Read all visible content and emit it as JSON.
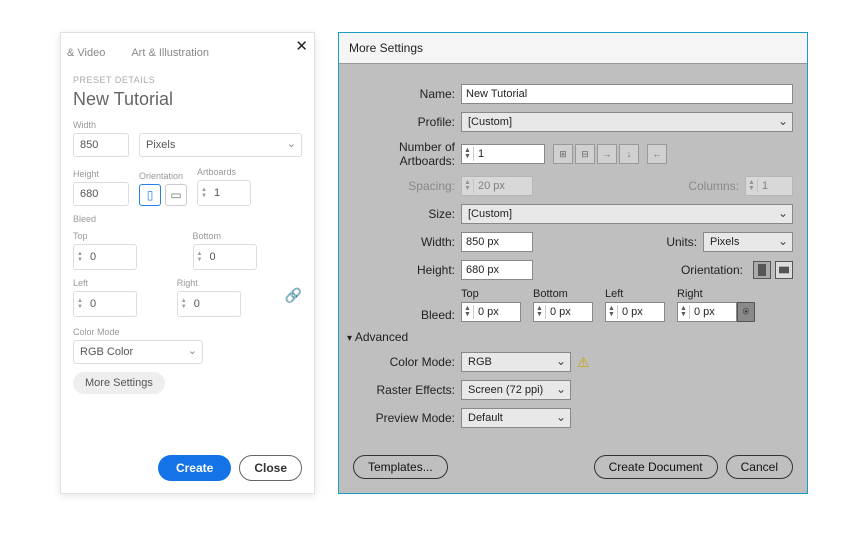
{
  "left": {
    "tabs": {
      "video": "& Video",
      "art": "Art & Illustration"
    },
    "preset_hdr": "PRESET DETAILS",
    "doc_name": "New Tutorial",
    "labels": {
      "width": "Width",
      "height": "Height",
      "orientation": "Orientation",
      "artboards": "Artboards",
      "bleed": "Bleed",
      "top": "Top",
      "bottom": "Bottom",
      "left": "Left",
      "right": "Right",
      "color_mode": "Color Mode"
    },
    "width": "850",
    "units": "Pixels",
    "height": "680",
    "artboards": "1",
    "bleed": {
      "top": "0",
      "bottom": "0",
      "left": "0",
      "right": "0"
    },
    "color_mode": "RGB Color",
    "more_settings": "More Settings",
    "create": "Create",
    "close": "Close"
  },
  "right": {
    "title": "More Settings",
    "labels": {
      "name": "Name:",
      "profile": "Profile:",
      "num_artboards": "Number of Artboards:",
      "spacing": "Spacing:",
      "columns": "Columns:",
      "size": "Size:",
      "width": "Width:",
      "units": "Units:",
      "height": "Height:",
      "orientation": "Orientation:",
      "bleed": "Bleed:",
      "top": "Top",
      "bottom": "Bottom",
      "left": "Left",
      "right": "Right",
      "advanced": "Advanced",
      "color_mode": "Color Mode:",
      "raster": "Raster Effects:",
      "preview": "Preview Mode:"
    },
    "name": "New Tutorial",
    "profile": "[Custom]",
    "num_artboards": "1",
    "spacing": "20 px",
    "columns": "1",
    "size": "[Custom]",
    "width": "850 px",
    "units": "Pixels",
    "height": "680 px",
    "bleed": {
      "top": "0 px",
      "bottom": "0 px",
      "left": "0 px",
      "right": "0 px"
    },
    "color_mode": "RGB",
    "raster": "Screen (72 ppi)",
    "preview": "Default",
    "templates": "Templates...",
    "create_doc": "Create Document",
    "cancel": "Cancel"
  }
}
